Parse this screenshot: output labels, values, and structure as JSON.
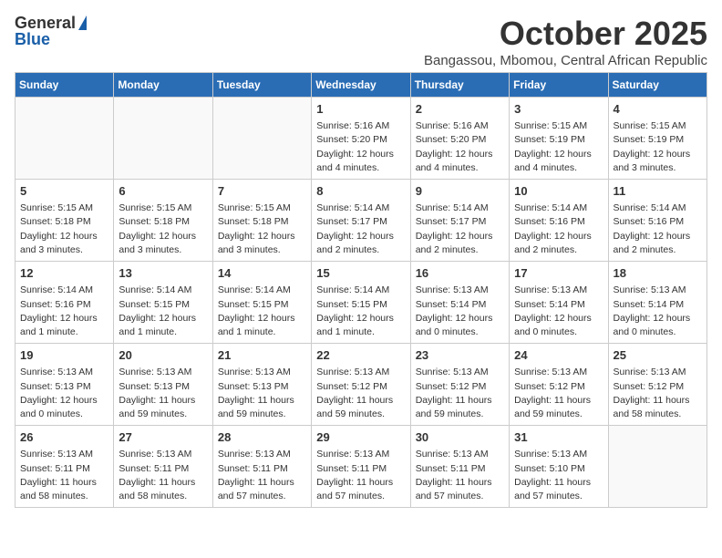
{
  "logo": {
    "general": "General",
    "blue": "Blue"
  },
  "header": {
    "month_year": "October 2025",
    "location": "Bangassou, Mbomou, Central African Republic"
  },
  "weekdays": [
    "Sunday",
    "Monday",
    "Tuesday",
    "Wednesday",
    "Thursday",
    "Friday",
    "Saturday"
  ],
  "weeks": [
    [
      {
        "day": "",
        "info": ""
      },
      {
        "day": "",
        "info": ""
      },
      {
        "day": "",
        "info": ""
      },
      {
        "day": "1",
        "info": "Sunrise: 5:16 AM\nSunset: 5:20 PM\nDaylight: 12 hours\nand 4 minutes."
      },
      {
        "day": "2",
        "info": "Sunrise: 5:16 AM\nSunset: 5:20 PM\nDaylight: 12 hours\nand 4 minutes."
      },
      {
        "day": "3",
        "info": "Sunrise: 5:15 AM\nSunset: 5:19 PM\nDaylight: 12 hours\nand 4 minutes."
      },
      {
        "day": "4",
        "info": "Sunrise: 5:15 AM\nSunset: 5:19 PM\nDaylight: 12 hours\nand 3 minutes."
      }
    ],
    [
      {
        "day": "5",
        "info": "Sunrise: 5:15 AM\nSunset: 5:18 PM\nDaylight: 12 hours\nand 3 minutes."
      },
      {
        "day": "6",
        "info": "Sunrise: 5:15 AM\nSunset: 5:18 PM\nDaylight: 12 hours\nand 3 minutes."
      },
      {
        "day": "7",
        "info": "Sunrise: 5:15 AM\nSunset: 5:18 PM\nDaylight: 12 hours\nand 3 minutes."
      },
      {
        "day": "8",
        "info": "Sunrise: 5:14 AM\nSunset: 5:17 PM\nDaylight: 12 hours\nand 2 minutes."
      },
      {
        "day": "9",
        "info": "Sunrise: 5:14 AM\nSunset: 5:17 PM\nDaylight: 12 hours\nand 2 minutes."
      },
      {
        "day": "10",
        "info": "Sunrise: 5:14 AM\nSunset: 5:16 PM\nDaylight: 12 hours\nand 2 minutes."
      },
      {
        "day": "11",
        "info": "Sunrise: 5:14 AM\nSunset: 5:16 PM\nDaylight: 12 hours\nand 2 minutes."
      }
    ],
    [
      {
        "day": "12",
        "info": "Sunrise: 5:14 AM\nSunset: 5:16 PM\nDaylight: 12 hours\nand 1 minute."
      },
      {
        "day": "13",
        "info": "Sunrise: 5:14 AM\nSunset: 5:15 PM\nDaylight: 12 hours\nand 1 minute."
      },
      {
        "day": "14",
        "info": "Sunrise: 5:14 AM\nSunset: 5:15 PM\nDaylight: 12 hours\nand 1 minute."
      },
      {
        "day": "15",
        "info": "Sunrise: 5:14 AM\nSunset: 5:15 PM\nDaylight: 12 hours\nand 1 minute."
      },
      {
        "day": "16",
        "info": "Sunrise: 5:13 AM\nSunset: 5:14 PM\nDaylight: 12 hours\nand 0 minutes."
      },
      {
        "day": "17",
        "info": "Sunrise: 5:13 AM\nSunset: 5:14 PM\nDaylight: 12 hours\nand 0 minutes."
      },
      {
        "day": "18",
        "info": "Sunrise: 5:13 AM\nSunset: 5:14 PM\nDaylight: 12 hours\nand 0 minutes."
      }
    ],
    [
      {
        "day": "19",
        "info": "Sunrise: 5:13 AM\nSunset: 5:13 PM\nDaylight: 12 hours\nand 0 minutes."
      },
      {
        "day": "20",
        "info": "Sunrise: 5:13 AM\nSunset: 5:13 PM\nDaylight: 11 hours\nand 59 minutes."
      },
      {
        "day": "21",
        "info": "Sunrise: 5:13 AM\nSunset: 5:13 PM\nDaylight: 11 hours\nand 59 minutes."
      },
      {
        "day": "22",
        "info": "Sunrise: 5:13 AM\nSunset: 5:12 PM\nDaylight: 11 hours\nand 59 minutes."
      },
      {
        "day": "23",
        "info": "Sunrise: 5:13 AM\nSunset: 5:12 PM\nDaylight: 11 hours\nand 59 minutes."
      },
      {
        "day": "24",
        "info": "Sunrise: 5:13 AM\nSunset: 5:12 PM\nDaylight: 11 hours\nand 59 minutes."
      },
      {
        "day": "25",
        "info": "Sunrise: 5:13 AM\nSunset: 5:12 PM\nDaylight: 11 hours\nand 58 minutes."
      }
    ],
    [
      {
        "day": "26",
        "info": "Sunrise: 5:13 AM\nSunset: 5:11 PM\nDaylight: 11 hours\nand 58 minutes."
      },
      {
        "day": "27",
        "info": "Sunrise: 5:13 AM\nSunset: 5:11 PM\nDaylight: 11 hours\nand 58 minutes."
      },
      {
        "day": "28",
        "info": "Sunrise: 5:13 AM\nSunset: 5:11 PM\nDaylight: 11 hours\nand 57 minutes."
      },
      {
        "day": "29",
        "info": "Sunrise: 5:13 AM\nSunset: 5:11 PM\nDaylight: 11 hours\nand 57 minutes."
      },
      {
        "day": "30",
        "info": "Sunrise: 5:13 AM\nSunset: 5:11 PM\nDaylight: 11 hours\nand 57 minutes."
      },
      {
        "day": "31",
        "info": "Sunrise: 5:13 AM\nSunset: 5:10 PM\nDaylight: 11 hours\nand 57 minutes."
      },
      {
        "day": "",
        "info": ""
      }
    ]
  ]
}
